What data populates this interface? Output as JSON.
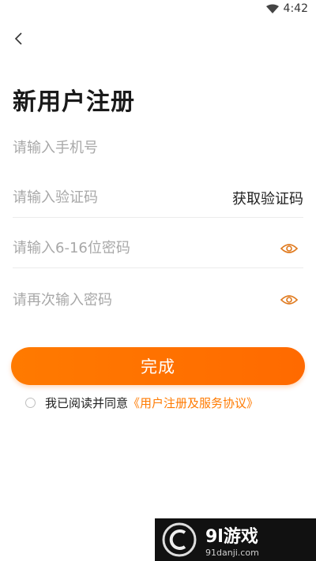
{
  "status_bar": {
    "time": "4:42"
  },
  "header": {
    "back_icon": "chevron-left-icon",
    "title": "新用户注册"
  },
  "form": {
    "phone": {
      "placeholder": "请输入手机号",
      "value": ""
    },
    "code": {
      "placeholder": "请输入验证码",
      "value": "",
      "get_code_label": "获取验证码"
    },
    "password": {
      "placeholder": "请输入6-16位密码",
      "value": "",
      "toggle_icon": "eye-icon"
    },
    "confirm_password": {
      "placeholder": "请再次输入密码",
      "value": "",
      "toggle_icon": "eye-icon"
    }
  },
  "submit": {
    "label": "完成"
  },
  "agreement": {
    "checked": false,
    "prefix": "我已阅读并同意",
    "link": "《用户注册及服务协议》"
  },
  "watermark": {
    "title": "9l游戏",
    "url": "91danji.com"
  },
  "colors": {
    "accent": "#ff7a00",
    "text": "#222222",
    "placeholder": "#a8a8a8",
    "divider": "#ececec"
  }
}
